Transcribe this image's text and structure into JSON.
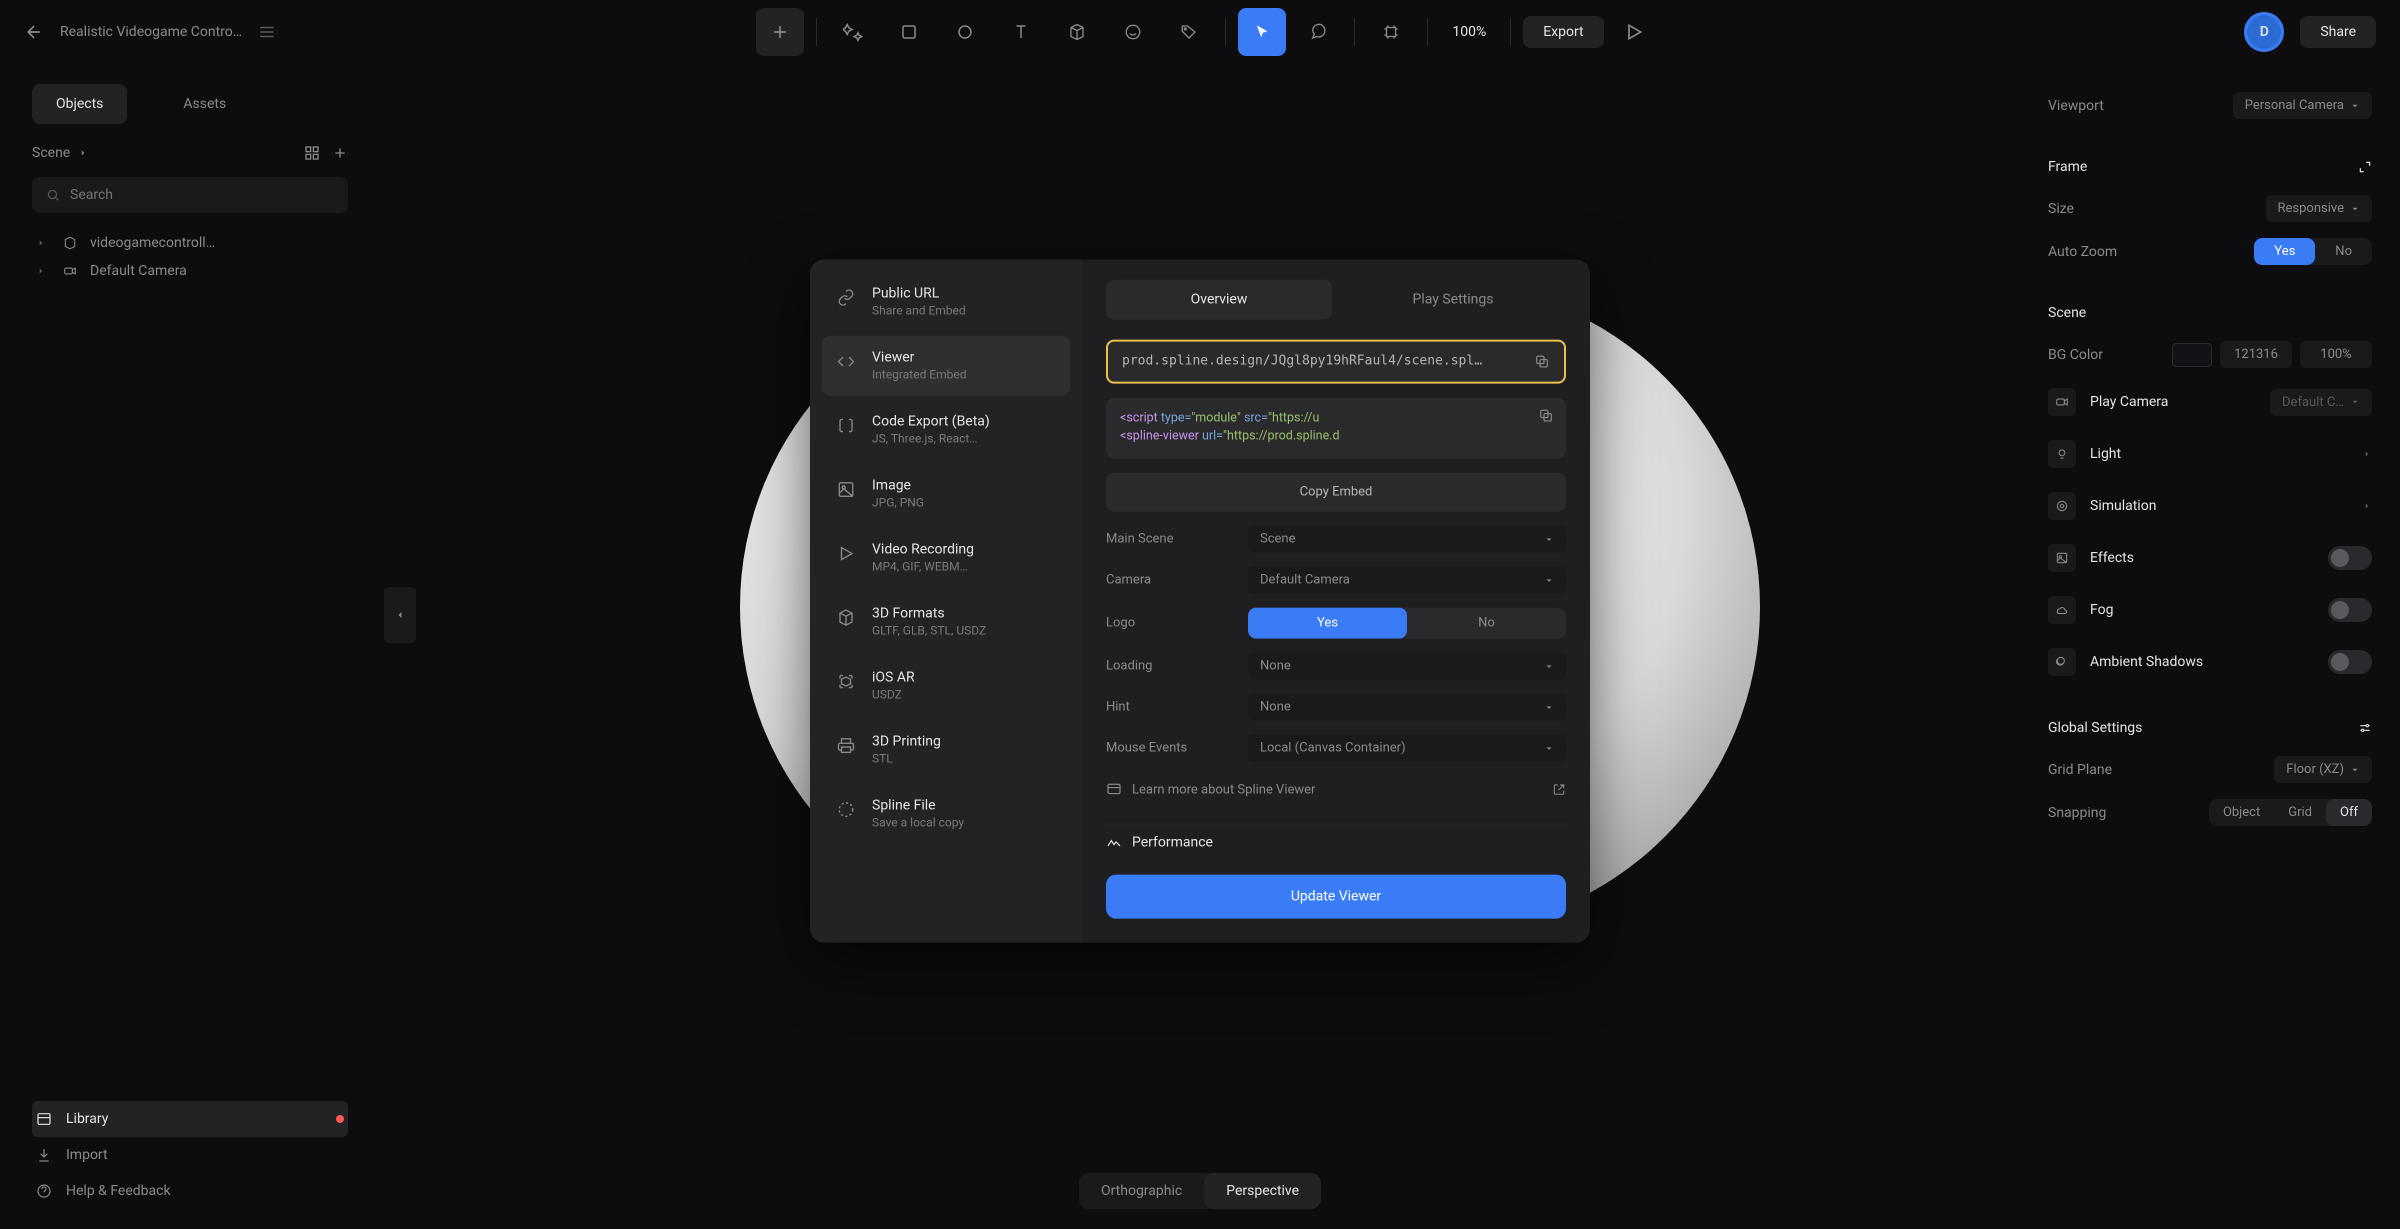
{
  "topbar": {
    "doc_title": "Realistic Videogame Contro…",
    "zoom": "100%",
    "export": "Export",
    "share": "Share",
    "avatar_initial": "D"
  },
  "left": {
    "tabs": {
      "objects": "Objects",
      "assets": "Assets"
    },
    "scene_label": "Scene",
    "search_placeholder": "Search",
    "tree": {
      "controller": "videogamecontroll…",
      "camera": "Default Camera"
    },
    "library": "Library",
    "import": "Import",
    "help": "Help & Feedback"
  },
  "right": {
    "viewport": "Viewport",
    "personal_camera": "Personal Camera",
    "frame": "Frame",
    "size": "Size",
    "size_val": "Responsive",
    "auto_zoom": "Auto Zoom",
    "yes": "Yes",
    "no": "No",
    "scene": "Scene",
    "bg_color": "BG Color",
    "bg_hex": "121316",
    "bg_alpha": "100%",
    "play_camera": "Play Camera",
    "play_camera_val": "Default C…",
    "light": "Light",
    "simulation": "Simulation",
    "effects": "Effects",
    "fog": "Fog",
    "ambient": "Ambient Shadows",
    "global": "Global Settings",
    "grid_plane": "Grid Plane",
    "grid_plane_val": "Floor (XZ)",
    "snapping": "Snapping",
    "snap_object": "Object",
    "snap_grid": "Grid",
    "snap_off": "Off"
  },
  "persp": {
    "ortho": "Orthographic",
    "persp": "Perspective"
  },
  "modal": {
    "side": [
      {
        "title": "Public URL",
        "sub": "Share and Embed"
      },
      {
        "title": "Viewer",
        "sub": "Integrated Embed"
      },
      {
        "title": "Code Export (Beta)",
        "sub": "JS, Three.js, React…"
      },
      {
        "title": "Image",
        "sub": "JPG, PNG"
      },
      {
        "title": "Video Recording",
        "sub": "MP4, GIF, WEBM…"
      },
      {
        "title": "3D Formats",
        "sub": "GLTF, GLB, STL, USDZ"
      },
      {
        "title": "iOS AR",
        "sub": "USDZ"
      },
      {
        "title": "3D Printing",
        "sub": "STL"
      },
      {
        "title": "Spline File",
        "sub": "Save a local copy"
      }
    ],
    "tabs": {
      "overview": "Overview",
      "play": "Play Settings"
    },
    "url": "prod.spline.design/JQgl8py19hRFaul4/scene.spl…",
    "code_line1a": "<script ",
    "code_line1b": "type=",
    "code_line1c": "\"module\"",
    "code_line1d": " src=",
    "code_line1e": "\"https://u",
    "code_line2a": "<spline-viewer ",
    "code_line2b": "url=",
    "code_line2c": "\"https://prod.spline.d",
    "copy_embed": "Copy Embed",
    "main_scene": "Main Scene",
    "main_scene_val": "Scene",
    "camera": "Camera",
    "camera_val": "Default Camera",
    "logo": "Logo",
    "logo_yes": "Yes",
    "logo_no": "No",
    "loading": "Loading",
    "loading_val": "None",
    "hint": "Hint",
    "hint_val": "None",
    "mouse": "Mouse Events",
    "mouse_val": "Local (Canvas Container)",
    "learn": "Learn more about Spline Viewer",
    "performance": "Performance",
    "update": "Update Viewer"
  }
}
